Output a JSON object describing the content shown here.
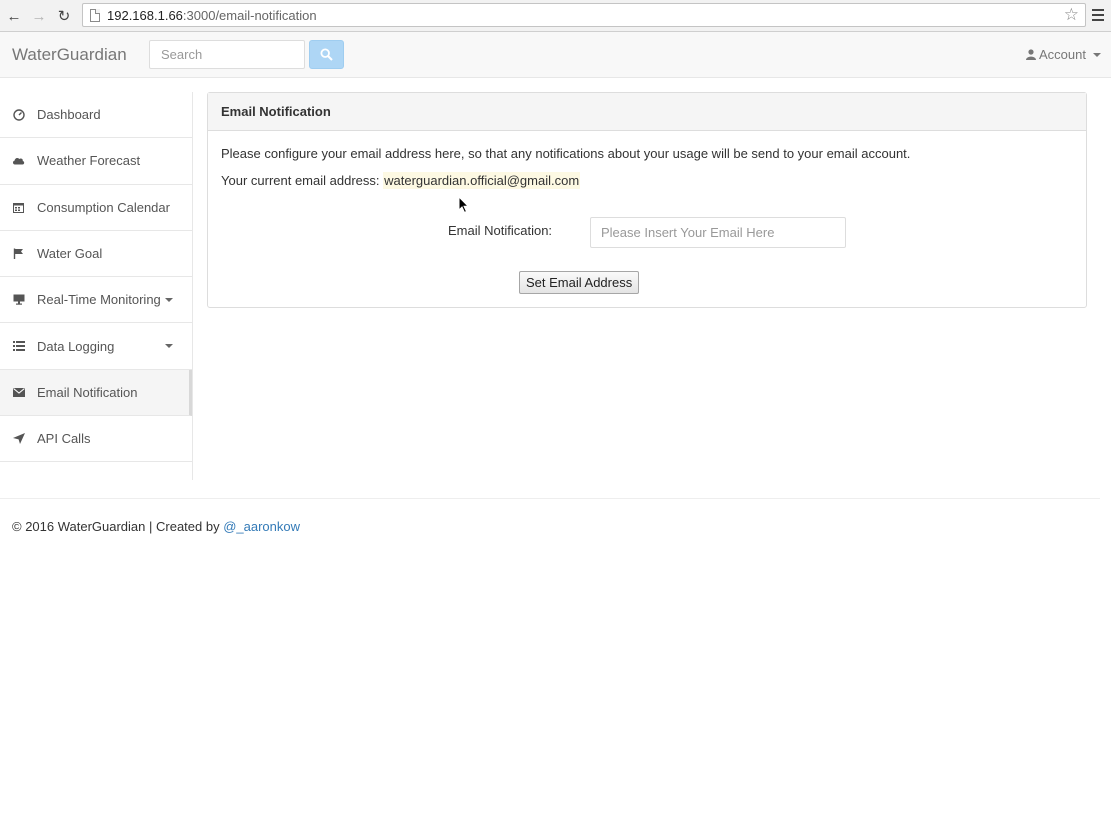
{
  "browser": {
    "url_host": "192.168.1.66",
    "url_rest": ":3000/email-notification"
  },
  "navbar": {
    "brand": "WaterGuardian",
    "search_placeholder": "Search",
    "account_label": "Account"
  },
  "sidebar": {
    "items": [
      {
        "label": "Dashboard",
        "icon": "dashboard-icon"
      },
      {
        "label": "Weather Forecast",
        "icon": "cloud-icon"
      },
      {
        "label": "Consumption Calendar",
        "icon": "calendar-icon"
      },
      {
        "label": "Water Goal",
        "icon": "flag-icon"
      },
      {
        "label": "Real-Time Monitoring",
        "icon": "monitor-icon",
        "dropdown": true
      },
      {
        "label": "Data Logging",
        "icon": "list-icon",
        "dropdown": true
      },
      {
        "label": "Email Notification",
        "icon": "envelope-icon",
        "active": true
      },
      {
        "label": "API Calls",
        "icon": "send-icon"
      }
    ]
  },
  "panel": {
    "title": "Email Notification",
    "description": "Please configure your email address here, so that any notifications about your usage will be send to your email account.",
    "current_label": "Your current email address:",
    "current_email": "waterguardian.official@gmail.com",
    "form_label": "Email Notification:",
    "email_placeholder": "Please Insert Your Email Here",
    "submit_label": "Set Email Address"
  },
  "footer": {
    "text": "© 2016 WaterGuardian | Created by",
    "link": "@_aaronkow"
  },
  "colors": {
    "accent_search": "#aed6f5",
    "link": "#337ab7",
    "email_highlight": "#fdf9e3"
  }
}
